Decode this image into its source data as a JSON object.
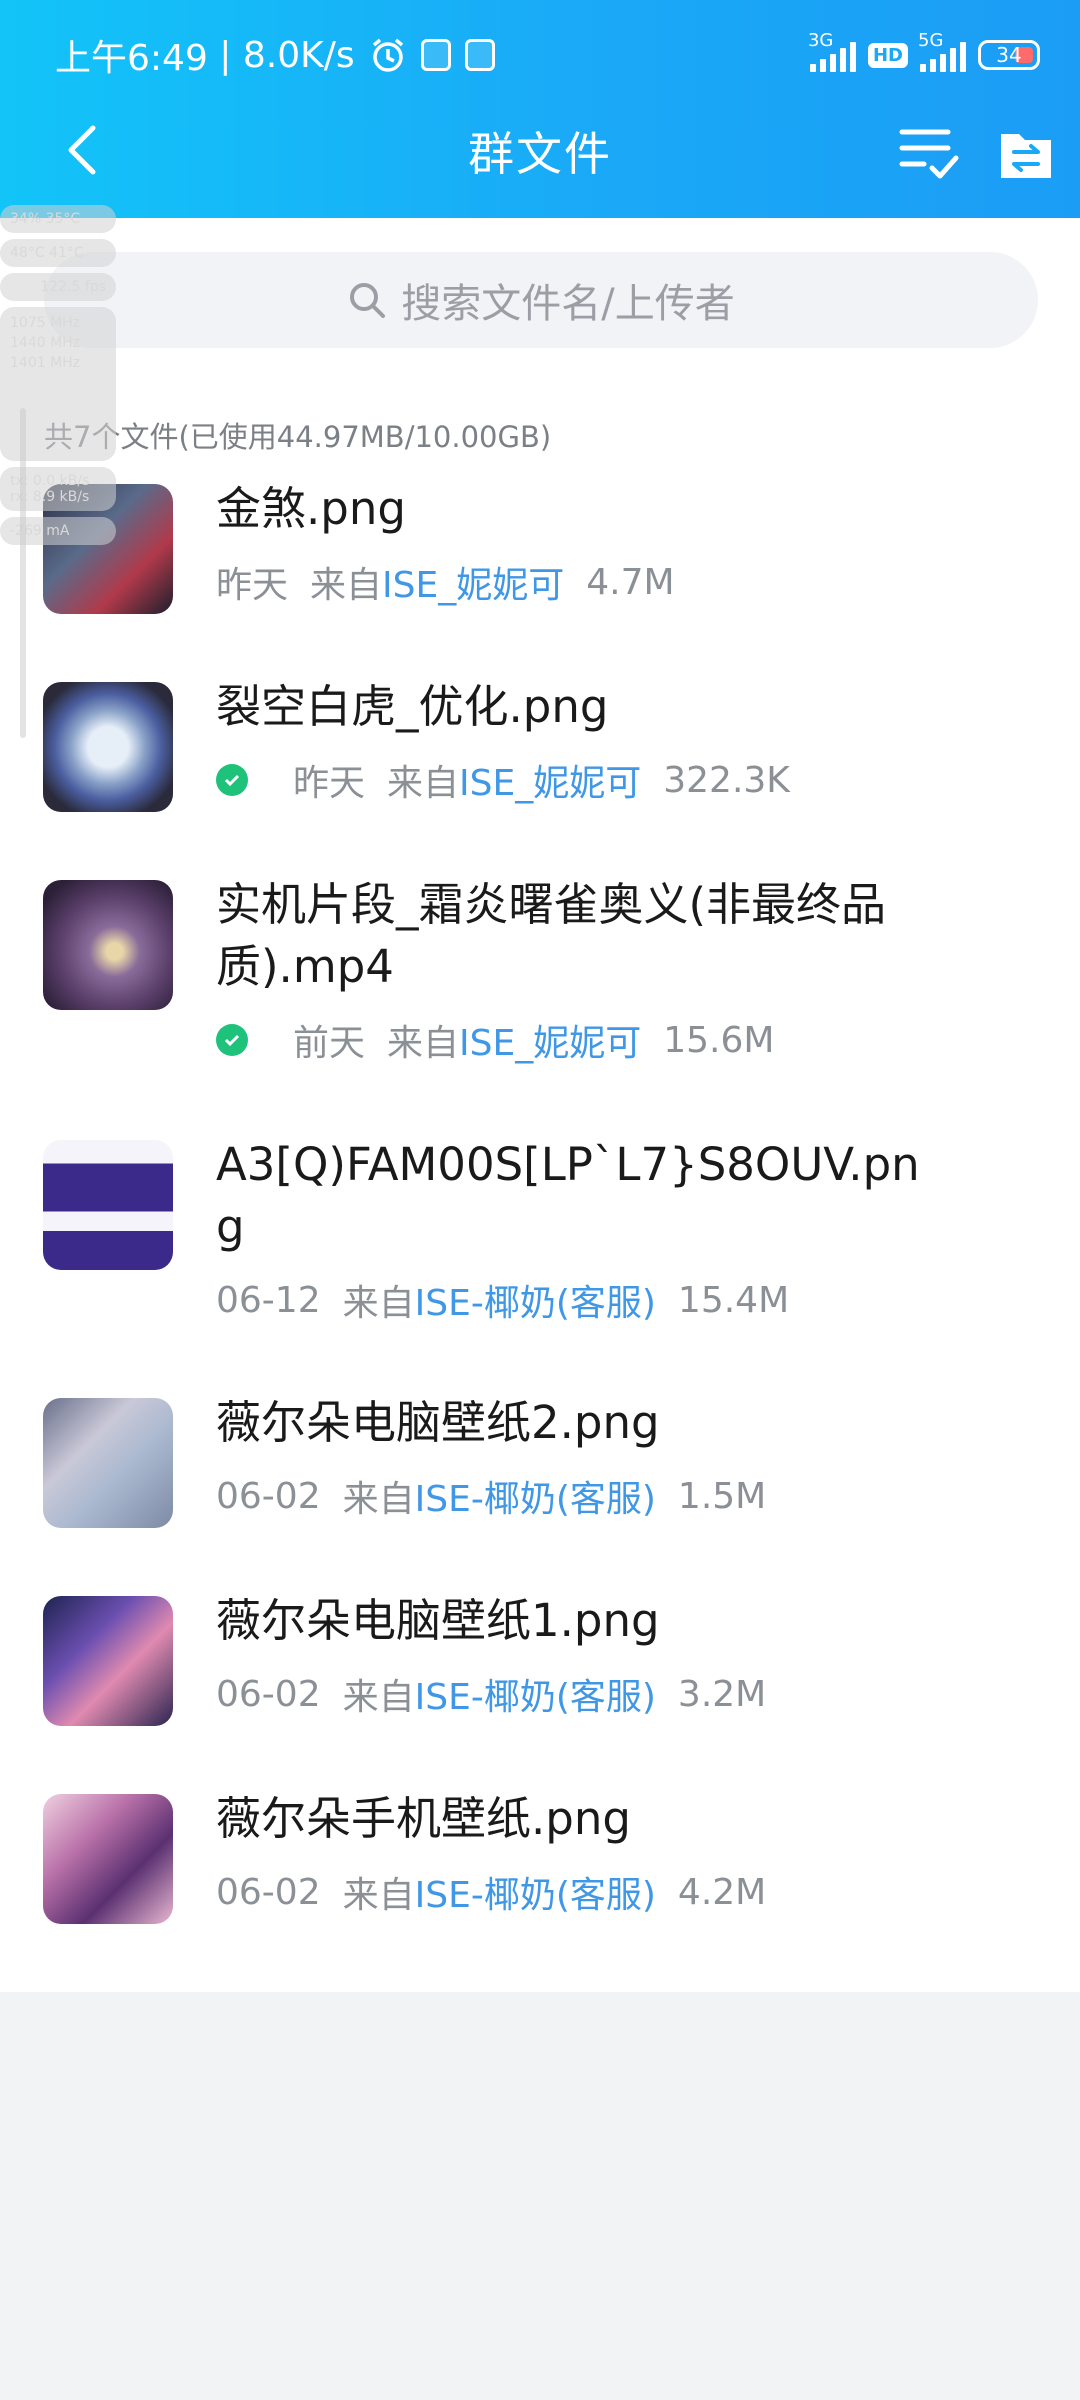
{
  "status_bar": {
    "time": "上午6:49",
    "net_speed": "8.0K/s",
    "sim1": "3G",
    "hd": "HD",
    "sim2": "5G",
    "battery": "34"
  },
  "header": {
    "title": "群文件"
  },
  "search": {
    "placeholder": "搜索文件名/上传者"
  },
  "summary": "共7个文件(已使用44.97MB/10.00GB)",
  "files": [
    {
      "name": "金煞.png",
      "date": "昨天",
      "from": "来自",
      "uploader": "ISE_妮妮可",
      "size": "4.7M",
      "downloaded": false
    },
    {
      "name": "裂空白虎_优化.png",
      "date": "昨天",
      "from": "来自",
      "uploader": "ISE_妮妮可",
      "size": "322.3K",
      "downloaded": true
    },
    {
      "name": "实机片段_霜炎曙雀奥义(非最终品质).mp4",
      "date": "前天",
      "from": "来自",
      "uploader": "ISE_妮妮可",
      "size": "15.6M",
      "downloaded": true
    },
    {
      "name": "A3[Q)FAM00S[LP`L7}S8OUV.png",
      "date": "06-12",
      "from": "来自",
      "uploader": "ISE-椰奶(客服)",
      "size": "15.4M",
      "downloaded": false
    },
    {
      "name": "薇尔朵电脑壁纸2.png",
      "date": "06-02",
      "from": "来自",
      "uploader": "ISE-椰奶(客服)",
      "size": "1.5M",
      "downloaded": false
    },
    {
      "name": "薇尔朵电脑壁纸1.png",
      "date": "06-02",
      "from": "来自",
      "uploader": "ISE-椰奶(客服)",
      "size": "3.2M",
      "downloaded": false
    },
    {
      "name": "薇尔朵手机壁纸.png",
      "date": "06-02",
      "from": "来自",
      "uploader": "ISE-椰奶(客服)",
      "size": "4.2M",
      "downloaded": false
    }
  ],
  "overlay": {
    "line1": "34%    35°C",
    "line2": "48°C    41°C",
    "line3": "122.5 fps",
    "line4": "1075 MHz",
    "line5": "1440 MHz",
    "line6": "1401 MHz",
    "line7": "tx: 0.0 kB/s",
    "line8": "rx: 8.9 kB/s",
    "line9": "-269 mA"
  },
  "colors": {
    "header_start": "#12c4f8",
    "header_end": "#1b9df6",
    "uploader": "#3f97e6",
    "downloaded_badge": "#1fc27a"
  }
}
